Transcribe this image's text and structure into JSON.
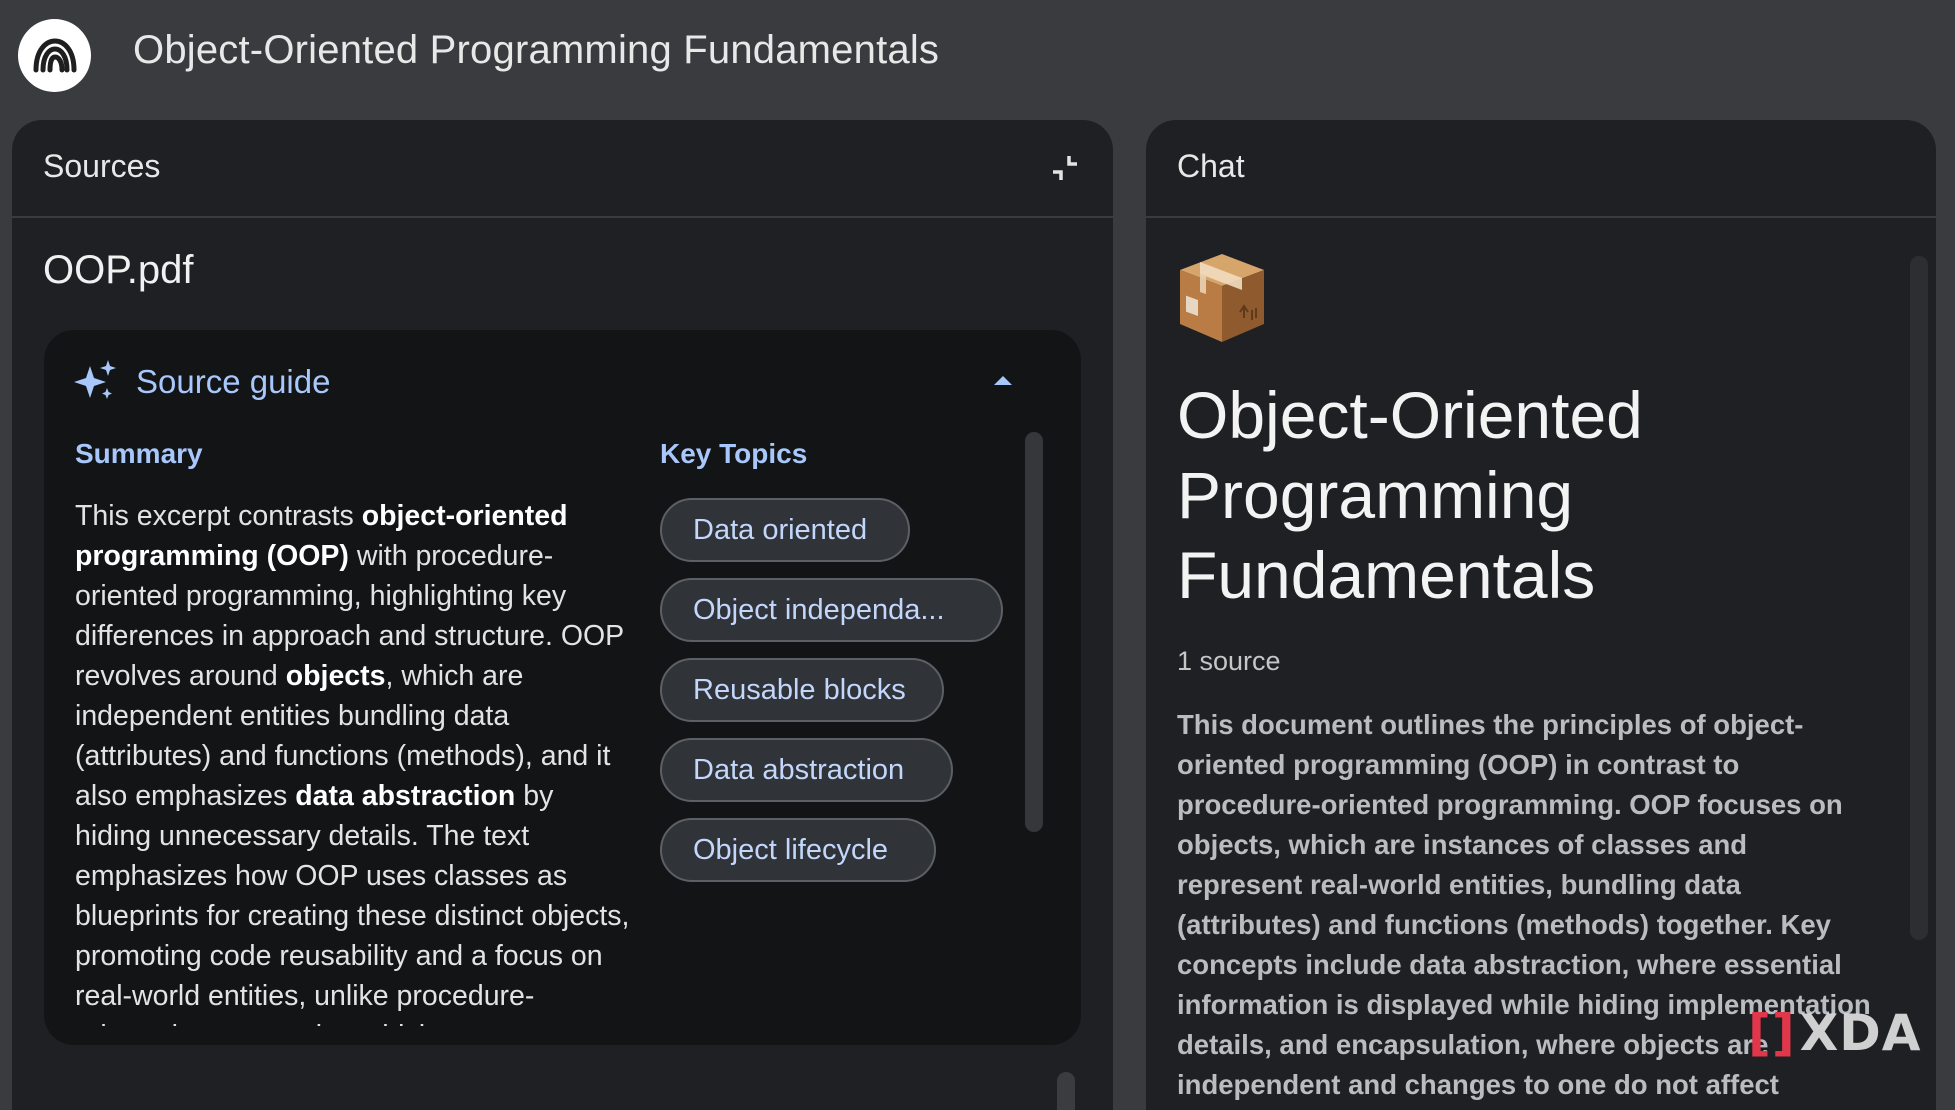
{
  "header": {
    "notebook_title": "Object-Oriented Programming Fundamentals",
    "logo_icon": "notebooklm-logo-icon"
  },
  "sources_panel": {
    "title": "Sources",
    "collapse_icon": "collapse-icon",
    "document_name": "OOP.pdf",
    "source_guide": {
      "title": "Source guide",
      "sparkle_icon": "sparkle-icon",
      "chevron_icon": "chevron-up-icon",
      "summary_label": "Summary",
      "summary_parts": [
        {
          "text": "This excerpt contrasts ",
          "bold": false
        },
        {
          "text": "object-oriented programming (OOP)",
          "bold": true
        },
        {
          "text": " with procedure-oriented programming, highlighting key differences in approach and structure. OOP revolves around ",
          "bold": false
        },
        {
          "text": "objects",
          "bold": true
        },
        {
          "text": ", which are independent entities bundling data (attributes) and functions (methods), and it also emphasizes ",
          "bold": false
        },
        {
          "text": "data abstraction",
          "bold": true
        },
        {
          "text": " by hiding unnecessary details. The text emphasizes how OOP uses classes as blueprints for creating these distinct objects, promoting code reusability and a focus on real-world entities, unlike procedure-oriented programming which",
          "bold": false
        }
      ],
      "topics_label": "Key Topics",
      "topics": [
        "Data oriented",
        "Object independa...",
        "Reusable blocks",
        "Data abstraction",
        "Object lifecycle"
      ]
    }
  },
  "chat_panel": {
    "title": "Chat",
    "emoji_icon": "package-box-icon",
    "notebook_title": "Object-Oriented Programming Fundamentals",
    "source_count": "1 source",
    "summary": "This document outlines the principles of object-oriented programming (OOP) in contrast to procedure-oriented programming. OOP focuses on objects, which are instances of classes and represent real-world entities, bundling data (attributes) and functions (methods) together. Key concepts include data abstraction, where essential information is displayed while hiding implementation details, and encapsulation, where objects are independent and changes to one do not affect others. Classes serve as"
  },
  "watermark": {
    "bracket": "[]",
    "text": "XDA"
  },
  "colors": {
    "background": "#3a3b3e",
    "panel": "#1f2023",
    "card": "#131416",
    "accent": "#a8c7fa",
    "chip_bg": "#303338"
  }
}
